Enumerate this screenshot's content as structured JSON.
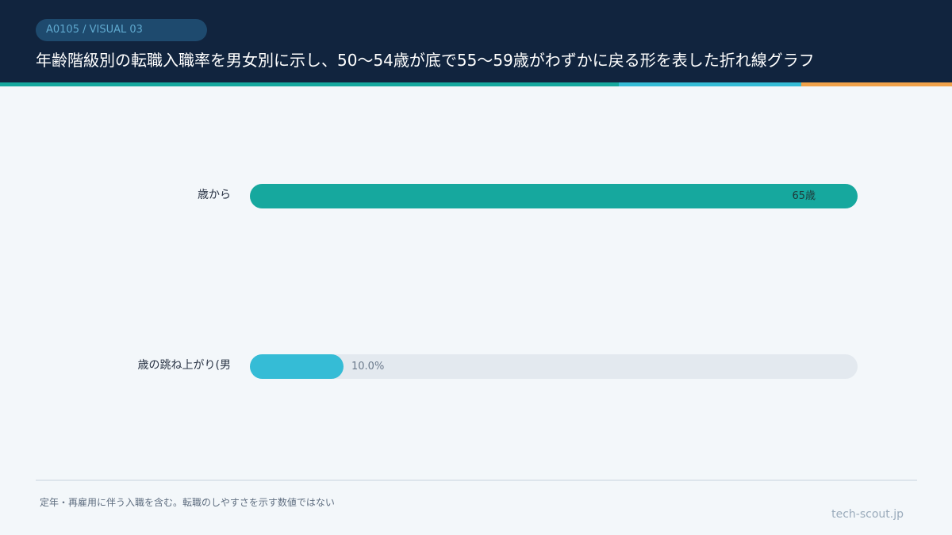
{
  "header": {
    "badge": "A0105 / VISUAL 03",
    "title": "年齢階級別の転職入職率を男女別に示し、50〜54歳が底で55〜59歳がわずかに戻る形を表した折れ線グラフ"
  },
  "colors": {
    "header_bg": "#11243e",
    "accent_1": "#16a89e",
    "accent_2": "#35bcd6",
    "accent_3": "#f0a24a",
    "track": "#e3e9ef"
  },
  "chart_data": {
    "type": "bar",
    "orientation": "horizontal",
    "categories": [
      "歳から",
      "歳の跳ね上がり(男"
    ],
    "value_labels": [
      "65歳",
      "10.0%"
    ],
    "fill_fractions": [
      1.0,
      0.154
    ],
    "colors": [
      "#16a89e",
      "#35bcd6"
    ]
  },
  "footer": {
    "note": "定年・再雇用に伴う入職を含む。転職のしやすさを示す数値ではない",
    "source": "tech-scout.jp"
  }
}
